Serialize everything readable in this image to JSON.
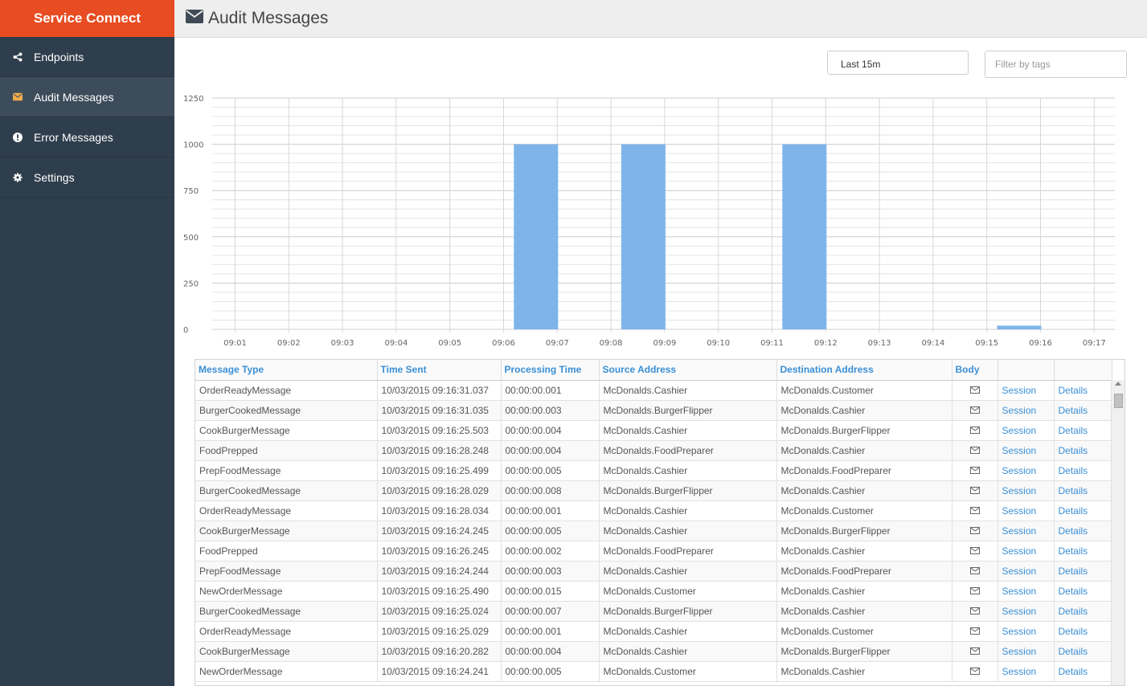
{
  "app": {
    "title": "Service Connect"
  },
  "sidebar": {
    "items": [
      {
        "label": "Endpoints",
        "icon": "share-icon",
        "active": false
      },
      {
        "label": "Audit Messages",
        "icon": "envelope-icon",
        "active": true
      },
      {
        "label": "Error Messages",
        "icon": "exclamation-circle-icon",
        "active": false
      },
      {
        "label": "Settings",
        "icon": "gear-icon",
        "active": false
      }
    ]
  },
  "header": {
    "title": "Audit Messages",
    "icon": "envelope-icon"
  },
  "filters": {
    "range_value": "Last 15m",
    "tags_placeholder": "Filter by tags"
  },
  "chart_data": {
    "type": "bar",
    "categories": [
      "09:01",
      "09:02",
      "09:03",
      "09:04",
      "09:05",
      "09:06",
      "09:07",
      "09:08",
      "09:09",
      "09:10",
      "09:11",
      "09:12",
      "09:13",
      "09:14",
      "09:15",
      "09:16",
      "09:17"
    ],
    "values": [
      0,
      0,
      0,
      0,
      0,
      0,
      1000,
      0,
      1000,
      0,
      0,
      1000,
      0,
      0,
      0,
      20,
      0
    ],
    "ylim": [
      0,
      1250
    ],
    "yticks": [
      0,
      250,
      500,
      750,
      1000,
      1250
    ],
    "grid": true,
    "bar_color": "#7eb4ea"
  },
  "table": {
    "columns": [
      "Message Type",
      "Time Sent",
      "Processing Time",
      "Source Address",
      "Destination Address",
      "Body",
      "",
      ""
    ],
    "session_label": "Session",
    "details_label": "Details",
    "rows": [
      [
        "OrderReadyMessage",
        "10/03/2015 09:16:31.037",
        "00:00:00.001",
        "McDonalds.Cashier",
        "McDonalds.Customer"
      ],
      [
        "BurgerCookedMessage",
        "10/03/2015 09:16:31.035",
        "00:00:00.003",
        "McDonalds.BurgerFlipper",
        "McDonalds.Cashier"
      ],
      [
        "CookBurgerMessage",
        "10/03/2015 09:16:25.503",
        "00:00:00.004",
        "McDonalds.Cashier",
        "McDonalds.BurgerFlipper"
      ],
      [
        "FoodPrepped",
        "10/03/2015 09:16:28.248",
        "00:00:00.004",
        "McDonalds.FoodPreparer",
        "McDonalds.Cashier"
      ],
      [
        "PrepFoodMessage",
        "10/03/2015 09:16:25.499",
        "00:00:00.005",
        "McDonalds.Cashier",
        "McDonalds.FoodPreparer"
      ],
      [
        "BurgerCookedMessage",
        "10/03/2015 09:16:28.029",
        "00:00:00.008",
        "McDonalds.BurgerFlipper",
        "McDonalds.Cashier"
      ],
      [
        "OrderReadyMessage",
        "10/03/2015 09:16:28.034",
        "00:00:00.001",
        "McDonalds.Cashier",
        "McDonalds.Customer"
      ],
      [
        "CookBurgerMessage",
        "10/03/2015 09:16:24.245",
        "00:00:00.005",
        "McDonalds.Cashier",
        "McDonalds.BurgerFlipper"
      ],
      [
        "FoodPrepped",
        "10/03/2015 09:16:26.245",
        "00:00:00.002",
        "McDonalds.FoodPreparer",
        "McDonalds.Cashier"
      ],
      [
        "PrepFoodMessage",
        "10/03/2015 09:16:24.244",
        "00:00:00.003",
        "McDonalds.Cashier",
        "McDonalds.FoodPreparer"
      ],
      [
        "NewOrderMessage",
        "10/03/2015 09:16:25.490",
        "00:00:00.015",
        "McDonalds.Customer",
        "McDonalds.Cashier"
      ],
      [
        "BurgerCookedMessage",
        "10/03/2015 09:16:25.024",
        "00:00:00.007",
        "McDonalds.BurgerFlipper",
        "McDonalds.Cashier"
      ],
      [
        "OrderReadyMessage",
        "10/03/2015 09:16:25.029",
        "00:00:00.001",
        "McDonalds.Cashier",
        "McDonalds.Customer"
      ],
      [
        "CookBurgerMessage",
        "10/03/2015 09:16:20.282",
        "00:00:00.004",
        "McDonalds.Cashier",
        "McDonalds.BurgerFlipper"
      ],
      [
        "NewOrderMessage",
        "10/03/2015 09:16:24.241",
        "00:00:00.005",
        "McDonalds.Customer",
        "McDonalds.Cashier"
      ]
    ]
  }
}
